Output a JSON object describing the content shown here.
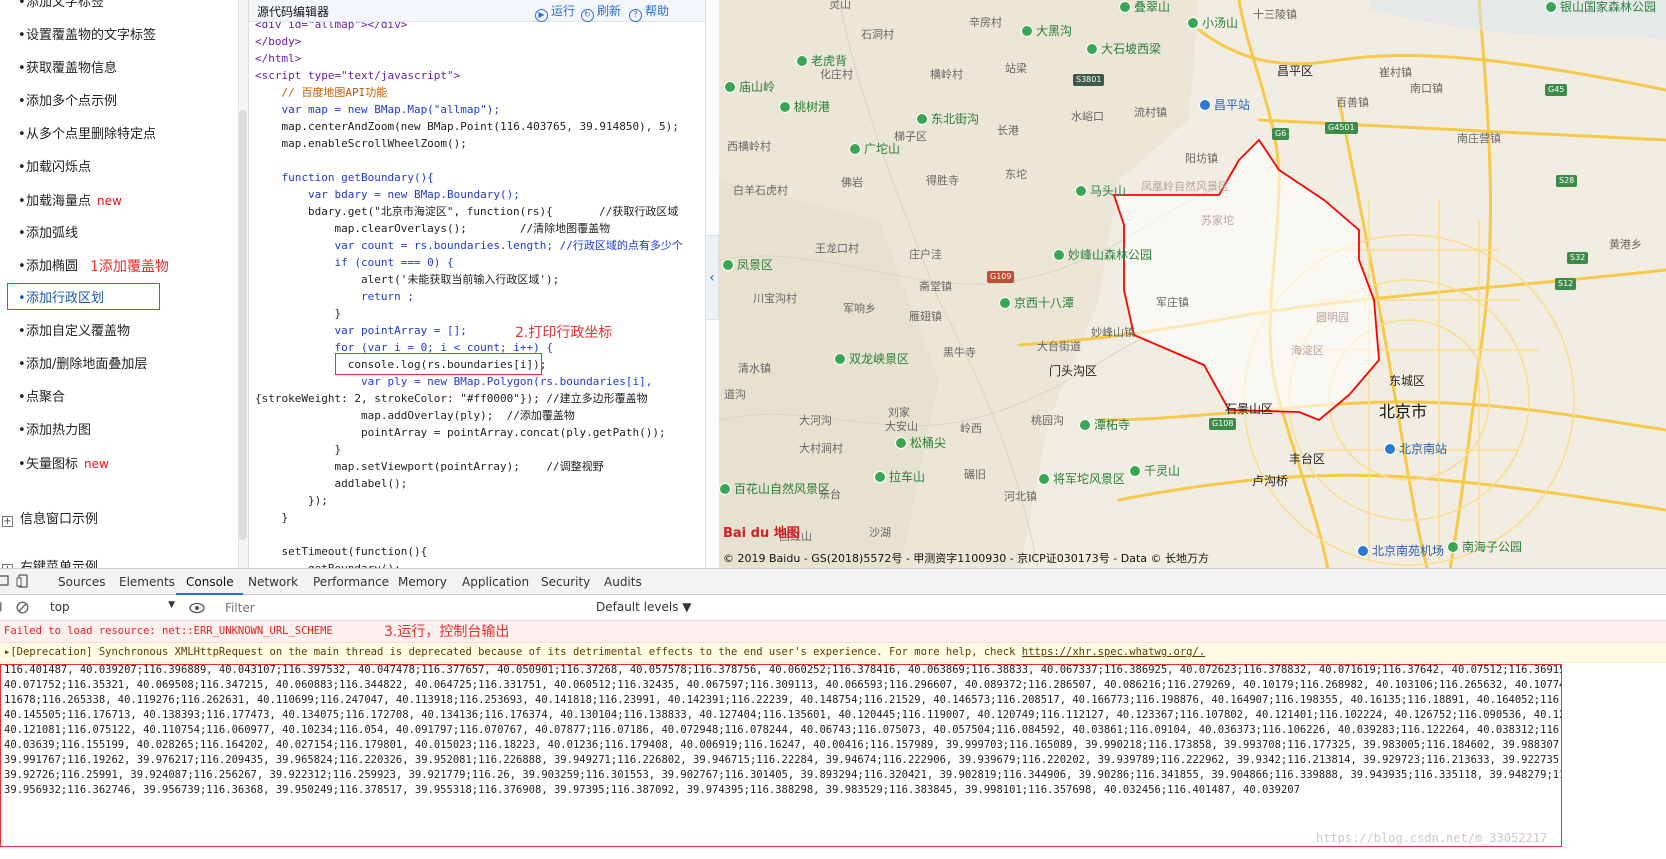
{
  "nav": {
    "items": [
      {
        "label": "添加文字标签",
        "badge": ""
      },
      {
        "label": "设置覆盖物的文字标签",
        "badge": ""
      },
      {
        "label": "获取覆盖物信息",
        "badge": ""
      },
      {
        "label": "添加多个点示例",
        "badge": ""
      },
      {
        "label": "从多个点里删除特定点",
        "badge": ""
      },
      {
        "label": "加载闪烁点",
        "badge": ""
      },
      {
        "label": "加载海量点",
        "badge": "new"
      },
      {
        "label": "添加弧线",
        "badge": ""
      },
      {
        "label": "添加椭圆",
        "badge": ""
      },
      {
        "label": "添加行政区划",
        "badge": ""
      },
      {
        "label": "添加自定义覆盖物",
        "badge": ""
      },
      {
        "label": "添加/删除地面叠加层",
        "badge": ""
      },
      {
        "label": "点聚合",
        "badge": ""
      },
      {
        "label": "添加热力图",
        "badge": ""
      },
      {
        "label": "矢量图标",
        "badge": "new"
      }
    ],
    "groups": [
      "信息窗口示例",
      "右键菜单示例"
    ],
    "annotation_1": "1添加覆盖物"
  },
  "editor": {
    "title": "源代码编辑器",
    "run": "运行",
    "refresh": "刷新",
    "help": "帮助",
    "annotation_2": "2.打印行政坐标",
    "lines": [
      "<div id=\"allmap\"></div>",
      "</body>",
      "</html>",
      "<script type=\"text/javascript\">",
      "    // 百度地图API功能",
      "    var map = new BMap.Map(\"allmap\");",
      "    map.centerAndZoom(new BMap.Point(116.403765, 39.914850), 5);",
      "    map.enableScrollWheelZoom();",
      "",
      "    function getBoundary(){",
      "        var bdary = new BMap.Boundary();",
      "        bdary.get(\"北京市海淀区\", function(rs){       //获取行政区域",
      "            map.clearOverlays();        //清除地图覆盖物",
      "            var count = rs.boundaries.length; //行政区域的点有多少个",
      "            if (count === 0) {",
      "                alert('未能获取当前输入行政区域');",
      "                return ;",
      "            }",
      "            var pointArray = [];",
      "            for (var i = 0; i < count; i++) {",
      "              console.log(rs.boundaries[i]);",
      "                var ply = new BMap.Polygon(rs.boundaries[i],",
      "{strokeWeight: 2, strokeColor: \"#ff0000\"}); //建立多边形覆盖物",
      "                map.addOverlay(ply);  //添加覆盖物",
      "                pointArray = pointArray.concat(ply.getPath());",
      "            }",
      "            map.setViewport(pointArray);    //调整视野",
      "            addlabel();",
      "        });",
      "    }",
      "",
      "    setTimeout(function(){",
      "        getBoundary();"
    ]
  },
  "map": {
    "labels": [
      {
        "text": "灵山",
        "kind": "gray"
      },
      {
        "text": "石洞村",
        "kind": "gray"
      },
      {
        "text": "辛房村",
        "kind": "gray"
      },
      {
        "text": "大黑沟",
        "kind": "green"
      },
      {
        "text": "叠翠山",
        "kind": "green"
      },
      {
        "text": "小汤山",
        "kind": "green"
      },
      {
        "text": "十三陵镇",
        "kind": "gray"
      },
      {
        "text": "银山国家森林公园",
        "kind": "green"
      },
      {
        "text": "老虎背",
        "kind": "green"
      },
      {
        "text": "化庄村",
        "kind": "gray"
      },
      {
        "text": "横岭村",
        "kind": "gray"
      },
      {
        "text": "站梁",
        "kind": "gray"
      },
      {
        "text": "大石坡西梁",
        "kind": "green"
      },
      {
        "text": "昌平区",
        "kind": "mid"
      },
      {
        "text": "崔村镇",
        "kind": "gray"
      },
      {
        "text": "庙山岭",
        "kind": "green"
      },
      {
        "text": "桃树港",
        "kind": "green"
      },
      {
        "text": "东北街沟",
        "kind": "green"
      },
      {
        "text": "水峪口",
        "kind": "gray"
      },
      {
        "text": "流村镇",
        "kind": "gray"
      },
      {
        "text": "昌平站",
        "kind": "blue"
      },
      {
        "text": "百善镇",
        "kind": "gray"
      },
      {
        "text": "广坨山",
        "kind": "green"
      },
      {
        "text": "梯子区",
        "kind": "gray"
      },
      {
        "text": "长港",
        "kind": "gray"
      },
      {
        "text": "南口镇",
        "kind": "gray"
      },
      {
        "text": "西横岭村",
        "kind": "gray"
      },
      {
        "text": "南庄营镇",
        "kind": "gray"
      },
      {
        "text": "阳坊镇",
        "kind": "gray"
      },
      {
        "text": "白羊石虎村",
        "kind": "gray"
      },
      {
        "text": "佛岩",
        "kind": "gray"
      },
      {
        "text": "得胜寺",
        "kind": "gray"
      },
      {
        "text": "东坨",
        "kind": "gray"
      },
      {
        "text": "马头山",
        "kind": "green"
      },
      {
        "text": "凤凰岭自然风景区",
        "kind": "pale"
      },
      {
        "text": "苏家坨",
        "kind": "pale"
      },
      {
        "text": "妙峰山森林公园",
        "kind": "green"
      },
      {
        "text": "庄户洼",
        "kind": "gray"
      },
      {
        "text": "王龙口村",
        "kind": "gray"
      },
      {
        "text": "黄港乡",
        "kind": "gray"
      },
      {
        "text": "凤景区",
        "kind": "green"
      },
      {
        "text": "斋堂镇",
        "kind": "gray"
      },
      {
        "text": "雁翅镇",
        "kind": "gray"
      },
      {
        "text": "京西十八潭",
        "kind": "green"
      },
      {
        "text": "军庄镇",
        "kind": "gray"
      },
      {
        "text": "圆明园",
        "kind": "pale"
      },
      {
        "text": "川宝沟村",
        "kind": "gray"
      },
      {
        "text": "军响乡",
        "kind": "gray"
      },
      {
        "text": "妙峰山镇",
        "kind": "gray"
      },
      {
        "text": "清水镇",
        "kind": "gray"
      },
      {
        "text": "双龙峡景区",
        "kind": "green"
      },
      {
        "text": "黑牛寺",
        "kind": "gray"
      },
      {
        "text": "大台街道",
        "kind": "gray"
      },
      {
        "text": "海淀区",
        "kind": "pale"
      },
      {
        "text": "门头沟区",
        "kind": "mid"
      },
      {
        "text": "东城区",
        "kind": "mid"
      },
      {
        "text": "北京市",
        "kind": "big"
      },
      {
        "text": "石景山区",
        "kind": "mid"
      },
      {
        "text": "大安山",
        "kind": "gray"
      },
      {
        "text": "刘家",
        "kind": "gray"
      },
      {
        "text": "大河沟",
        "kind": "gray"
      },
      {
        "text": "桃园沟",
        "kind": "gray"
      },
      {
        "text": "潭柘寺",
        "kind": "green"
      },
      {
        "text": "松桶尖",
        "kind": "green"
      },
      {
        "text": "岭西",
        "kind": "gray"
      },
      {
        "text": "北京南站",
        "kind": "blue"
      },
      {
        "text": "大村涧村",
        "kind": "gray"
      },
      {
        "text": "丰台区",
        "kind": "mid"
      },
      {
        "text": "千灵山",
        "kind": "green"
      },
      {
        "text": "拉车山",
        "kind": "green"
      },
      {
        "text": "碾旧",
        "kind": "gray"
      },
      {
        "text": "将军坨风景区",
        "kind": "green"
      },
      {
        "text": "卢沟桥",
        "kind": "mid"
      },
      {
        "text": "百花山自然风景区",
        "kind": "green"
      },
      {
        "text": "东台",
        "kind": "gray"
      },
      {
        "text": "河北镇",
        "kind": "gray"
      },
      {
        "text": "西红山",
        "kind": "gray"
      },
      {
        "text": "沙湖",
        "kind": "gray"
      },
      {
        "text": "北京南苑机场",
        "kind": "blue"
      },
      {
        "text": "南海子公园",
        "kind": "green"
      },
      {
        "text": "道沟",
        "kind": "gray"
      }
    ],
    "shields": [
      "S3801",
      "G6",
      "G4501",
      "G45",
      "S28",
      "G109",
      "G108",
      "S32",
      "S12"
    ],
    "logo": "Bai du 地图",
    "copyright": "© 2019 Baidu - GS(2018)5572号 - 甲测资字1100930 - 京ICP证030173号 - Data © 长地万方"
  },
  "devtools": {
    "tabs": [
      "Sources",
      "Elements",
      "Console",
      "Network",
      "Performance",
      "Memory",
      "Application",
      "Security",
      "Audits"
    ],
    "active_tab": "Console",
    "context": "top",
    "filter_placeholder": "Filter",
    "levels": "Default levels ▼",
    "error_text": "Failed to load resource: net::ERR_UNKNOWN_URL_SCHEME",
    "annotation_3": "3.运行，控制台输出",
    "warn_text": "▸[Deprecation] Synchronous XMLHttpRequest on the main thread is deprecated because of its detrimental effects to the end user's experience. For more help, check ",
    "warn_link": "https://xhr.spec.whatwg.org/.",
    "data_lines": [
      "116.401487, 40.039207;116.396889, 40.043107;116.397532, 40.047478;116.377657, 40.050901;116.37268, 40.057578;116.378756, 40.060252;116.378416, 40.063869;116.38833, 40.067337;116.386925, 40.072623;116.378832, 40.071619;116.37642, 40.07512;116.369154, 40.",
      "40.071752;116.35321, 40.069508;116.347215, 40.060883;116.344822, 40.064725;116.331751, 40.060512;116.32435, 40.067597;116.309113, 40.066593;116.296607, 40.089372;116.286507, 40.086216;116.279269, 40.10179;116.268982, 40.103106;116.265632, 40.107748;116.",
      "11678;116.265338, 40.119276;116.262631, 40.110699;116.247047, 40.113918;116.253693, 40.141818;116.23991, 40.142391;116.22239, 40.148754;116.21529, 40.146573;116.208517, 40.166773;116.198876, 40.164907;116.198355, 40.16135;116.18891, 40.164052;116.18",
      "40.145505;116.176713, 40.138393;116.177473, 40.134075;116.172708, 40.134136;116.176374, 40.130104;116.138833, 40.127404;116.135601, 40.120445;116.119007, 40.120749;116.112127, 40.123367;116.107802, 40.121401;116.102224, 40.126752;116.090536, 40.125619;",
      "40.121081;116.075122, 40.110754;116.060977, 40.10234;116.054, 40.091797;116.070767, 40.07877;116.07186, 40.072948;116.078244, 40.06743;116.075073, 40.057504;116.084592, 40.03861;116.09104, 40.036373;116.106226, 40.039283;116.122264, 40.038312;116.12814",
      "40.03639;116.155199, 40.028265;116.164202, 40.027154;116.179801, 40.015023;116.18223, 40.01236;116.179408, 40.006919;116.16247, 40.00416;116.157989, 39.999703;116.165089, 39.990218;116.173858, 39.993708;116.177325, 39.983005;116.184602, 39.988307;116.18",
      "39.991767;116.19262, 39.976217;116.209435, 39.965824;116.220326, 39.952081;116.226888, 39.949271;116.226802, 39.946715;116.22284, 39.94674;116.222906, 39.939679;116.220202, 39.939789;116.222962, 39.9342;116.213814, 39.929723;116.213633, 39.922735;116.2",
      "39.92726;116.25991, 39.924087;116.256267, 39.922312;116.259923, 39.921779;116.26, 39.903259;116.301553, 39.902767;116.301405, 39.893294;116.320421, 39.902819;116.344906, 39.90286;116.341855, 39.904866;116.339888, 39.943935;116.335118, 39.948279;116.3",
      "39.956932;116.362746, 39.956739;116.36368, 39.950249;116.378517, 39.955318;116.376908, 39.97395;116.387092, 39.974395;116.388298, 39.983529;116.383845, 39.998101;116.357698, 40.032456;116.401487, 40.039207"
    ],
    "watermark": "https://blog.csdn.net/m_33052217"
  }
}
